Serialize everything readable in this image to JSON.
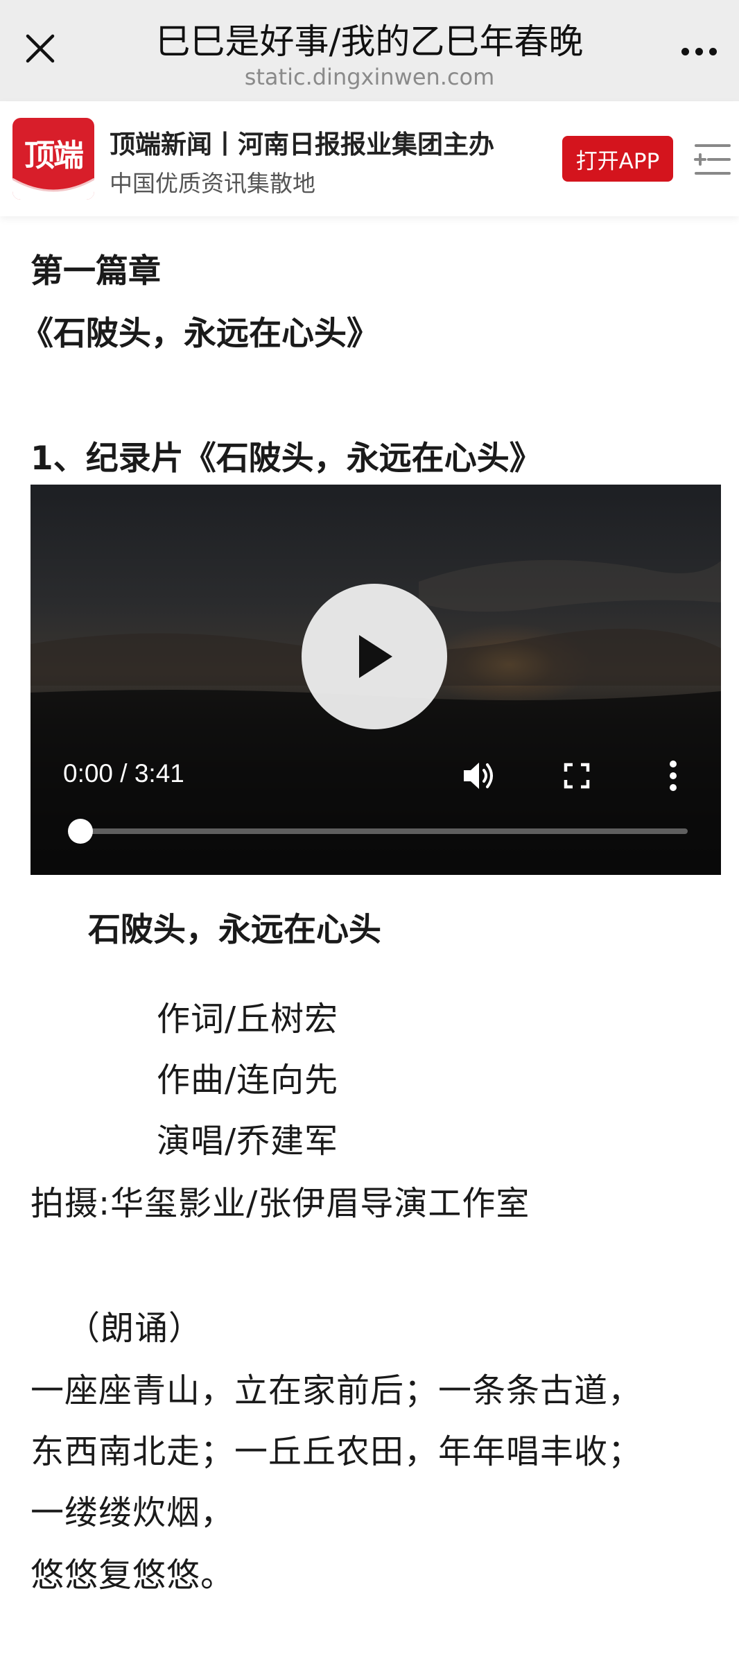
{
  "browser": {
    "title": "巳巳是好事/我的乙巳年春晚",
    "url": "static.dingxinwen.com"
  },
  "site_header": {
    "logo_text": "顶端",
    "site_name": "顶端新闻丨河南日报报业集团主办",
    "slogan": "中国优质资讯集散地",
    "open_app_label": "打开APP",
    "brand_color": "#d4141d"
  },
  "article": {
    "chapter": "第一篇章",
    "chapter_title": "《石陂头，永远在心头》",
    "section_title": "1、纪录片《石陂头，永远在心头》",
    "video": {
      "time": "0:00 / 3:41",
      "progress": 0
    },
    "song_title": "石陂头，永远在心头",
    "credits": [
      "作词/丘树宏",
      "作曲/连向先",
      "演唱/乔建军"
    ],
    "filming": "拍摄:华玺影业/张伊眉导演工作室",
    "recitation_label": "（朗诵）",
    "lines": [
      "一座座青山，立在家前后；一条条古道，",
      "东西南北走；一丘丘农田，年年唱丰收；",
      "一缕缕炊烟，",
      "悠悠复悠悠。"
    ]
  },
  "icons": {
    "close": "close-icon",
    "more": "more-icon",
    "menu": "menu-icon",
    "play": "play-icon",
    "volume": "volume-icon",
    "fullscreen": "fullscreen-icon",
    "video_more": "video-more-icon"
  }
}
